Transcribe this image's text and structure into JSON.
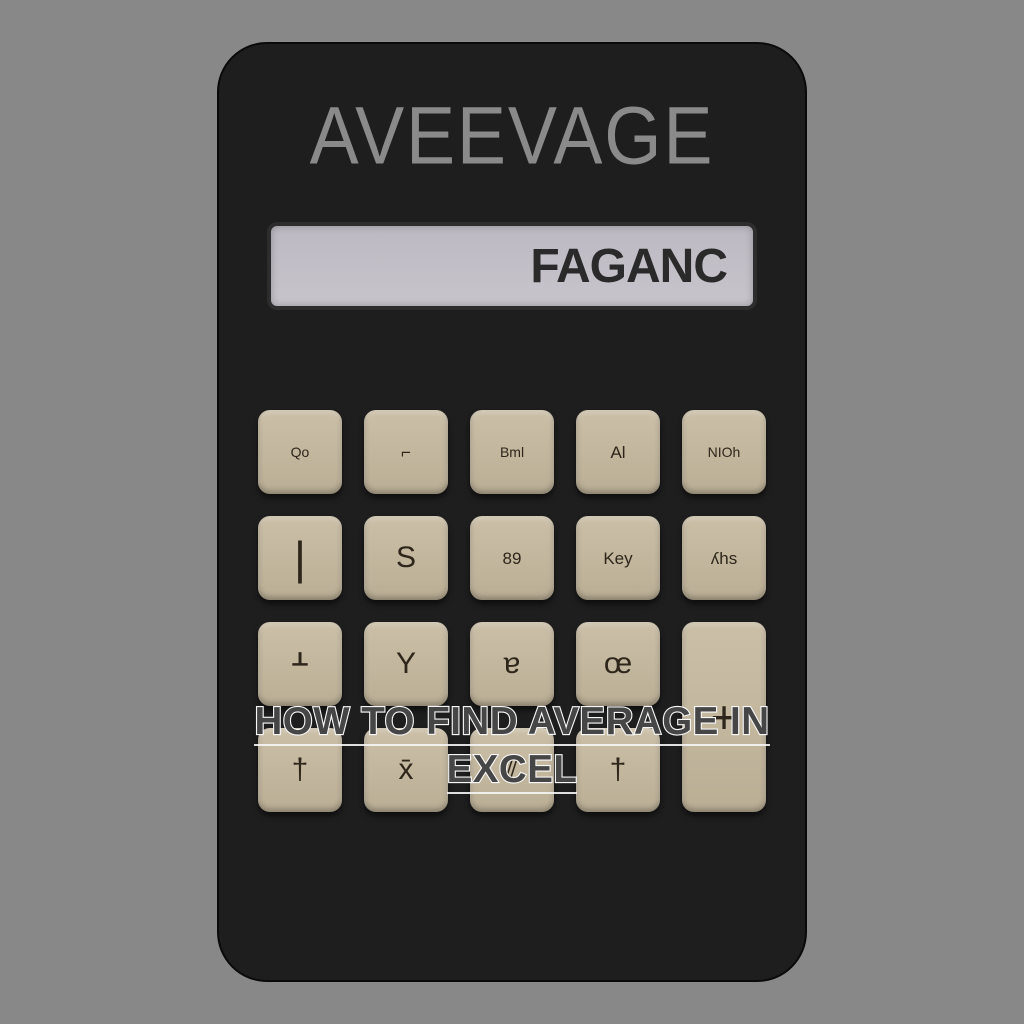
{
  "brand": "AVEEVAGE",
  "display_value": "FAGANC",
  "keys": {
    "r1c1": "Qo",
    "r1c2": "⌐",
    "r1c3": "Bml",
    "r1c4": "Al",
    "r1c5": "NIOh",
    "r2c1": "|",
    "r2c2": "S",
    "r2c3": "89",
    "r2c4": "Key",
    "r2c5": "ʎhs",
    "r3c1": "ᚆ",
    "r3c2": "Y",
    "r3c3": "ɐ",
    "r3c4": "œ",
    "r3c5": "+",
    "r4c1": "†",
    "r4c2": "x̄",
    "r4c3": "⫽",
    "r4c4": "†"
  },
  "overlay": {
    "line1": "HOW TO FIND AVERAGE IN",
    "line2": "EXCEL"
  }
}
